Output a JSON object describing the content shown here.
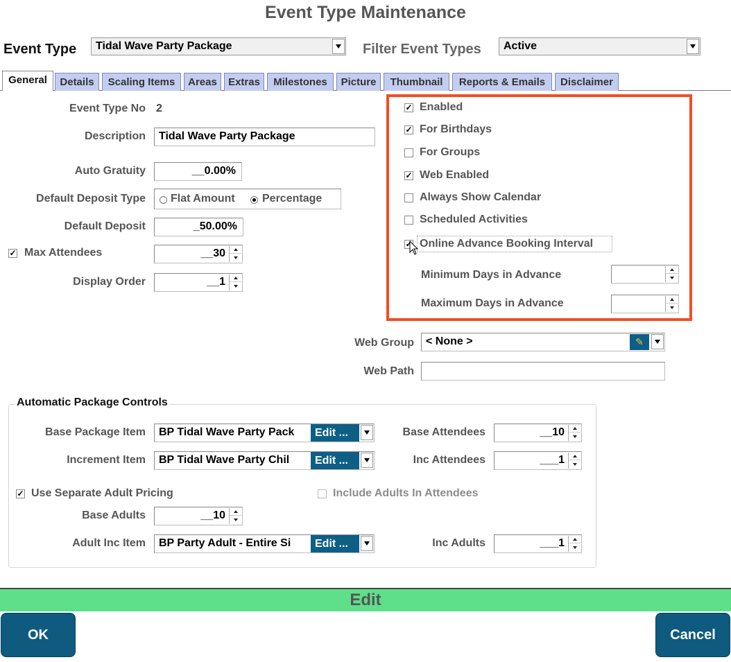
{
  "window": {
    "title": "Event Type Maintenance"
  },
  "header": {
    "event_type_label": "Event Type",
    "event_type_value": "Tidal Wave Party Package",
    "filter_label": "Filter Event Types",
    "filter_value": "Active"
  },
  "tabs": [
    "General",
    "Details",
    "Scaling Items",
    "Areas",
    "Extras",
    "Milestones",
    "Picture",
    "Thumbnail",
    "Reports & Emails",
    "Disclaimer"
  ],
  "general": {
    "event_type_no_label": "Event Type No",
    "event_type_no_value": "2",
    "description_label": "Description",
    "description_value": "Tidal Wave Party Package",
    "auto_gratuity_label": "Auto Gratuity",
    "auto_gratuity_value": "__0.00%",
    "deposit_type_label": "Default Deposit Type",
    "deposit_type_options": [
      "Flat Amount",
      "Percentage"
    ],
    "deposit_type_selected": "Percentage",
    "default_deposit_label": "Default Deposit",
    "default_deposit_value": "_50.00%",
    "max_attendees_label": "Max Attendees",
    "max_attendees_checked": true,
    "max_attendees_value": "__30",
    "display_order_label": "Display Order",
    "display_order_value": "__1"
  },
  "options": {
    "enabled": {
      "label": "Enabled",
      "checked": true
    },
    "for_birthdays": {
      "label": "For Birthdays",
      "checked": true
    },
    "for_groups": {
      "label": "For Groups",
      "checked": false
    },
    "web_enabled": {
      "label": "Web Enabled",
      "checked": true
    },
    "always_show_calendar": {
      "label": "Always Show Calendar",
      "checked": false
    },
    "scheduled_activities": {
      "label": "Scheduled Activities",
      "checked": false
    },
    "online_advance_booking": {
      "label": "Online Advance Booking Interval",
      "checked": true
    },
    "min_days_label": "Minimum Days in Advance",
    "min_days_value": "",
    "max_days_label": "Maximum Days in Advance",
    "max_days_value": "",
    "highlight_color": "#f04e23"
  },
  "web": {
    "web_group_label": "Web Group",
    "web_group_value": "< None >",
    "web_path_label": "Web Path",
    "web_path_value": ""
  },
  "package_controls": {
    "title": "Automatic Package Controls",
    "base_package_label": "Base Package Item",
    "base_package_value": "BP Tidal Wave Party Pack",
    "increment_label": "Increment Item",
    "increment_value": "BP Tidal Wave Party Chil",
    "edit_label": "Edit ...",
    "base_attendees_label": "Base Attendees",
    "base_attendees_value": "__10",
    "inc_attendees_label": "Inc Attendees",
    "inc_attendees_value": "___1",
    "separate_adult_label": "Use Separate Adult Pricing",
    "separate_adult_checked": true,
    "include_adults_label": "Include Adults In Attendees",
    "include_adults_checked": false,
    "base_adults_label": "Base Adults",
    "base_adults_value": "__10",
    "adult_inc_label": "Adult Inc Item",
    "adult_inc_value": "BP Party Adult - Entire Si",
    "inc_adults_label": "Inc Adults",
    "inc_adults_value": "___1"
  },
  "footer": {
    "mode": "Edit",
    "ok_label": "OK",
    "cancel_label": "Cancel",
    "mode_color": "#5ee08a",
    "button_color": "#0e5b7f"
  }
}
